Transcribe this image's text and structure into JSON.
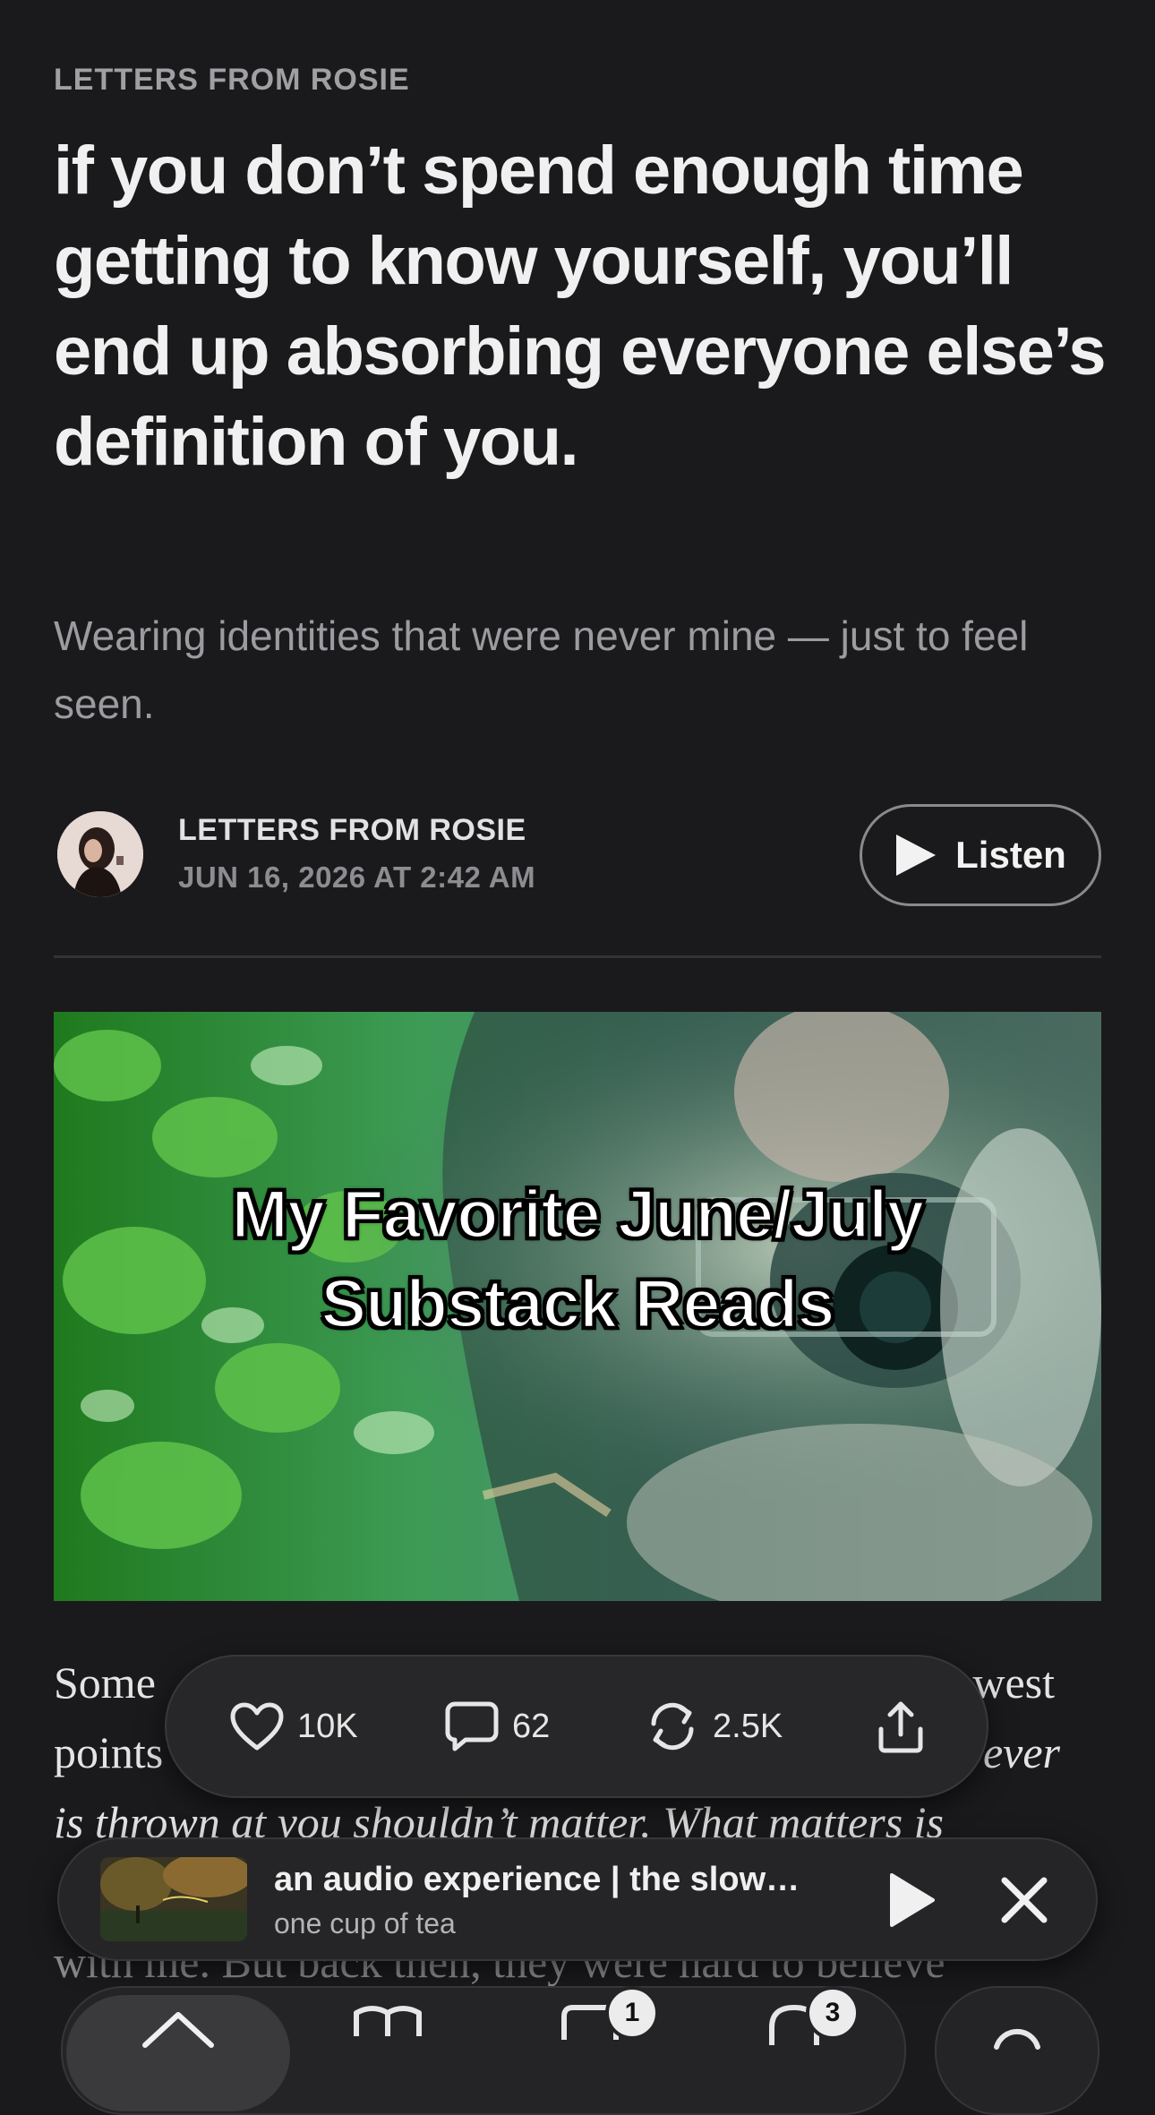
{
  "post": {
    "publication_kicker": "LETTERS FROM ROSIE",
    "title": "if you don’t spend enough time getting to know yourself, you’ll end up absorbing everyone else’s definition of you.",
    "subtitle": "Wearing identities that were never mine — just to feel seen.",
    "author": "LETTERS FROM ROSIE",
    "date": "JUN 16, 2026 AT 2:42 AM",
    "listen_label": "Listen",
    "hero_caption_line1": "My Favorite June/July",
    "hero_caption_line2": "Substack Reads",
    "body_p1_a": "Some",
    "body_p1_b": "west",
    "body_p2_a": "points",
    "body_p2_b": "ever",
    "body_p3": "is thrown at you shouldn’t matter. What matters is",
    "body_p4": "with me. But back then, they were hard to believe"
  },
  "actions": {
    "likes": "10K",
    "comments": "62",
    "restacks": "2.5K"
  },
  "now_playing": {
    "title": "an audio experience | the slow…",
    "subtitle": "one cup of tea"
  },
  "tabbar": {
    "chat_badge": "1",
    "activity_badge": "3"
  },
  "colors": {
    "background": "#1a1a1c",
    "text_primary": "#f0f0f0",
    "text_secondary": "#9c9ca0"
  }
}
